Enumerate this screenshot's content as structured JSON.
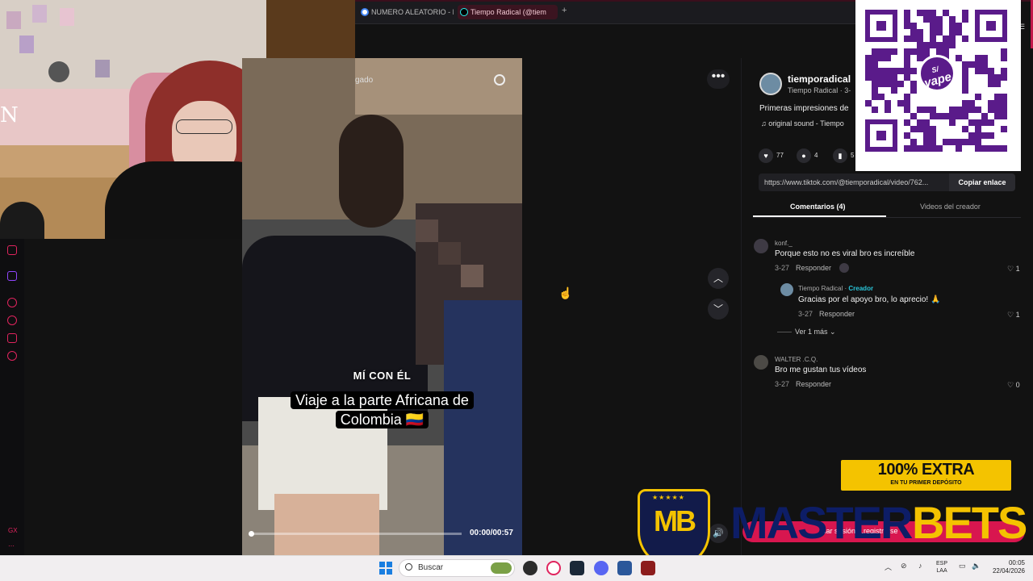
{
  "browser": {
    "tabs": [
      {
        "label": "NUMERO ALEATORIO - Bu",
        "active": false
      },
      {
        "label": "Tiempo Radical (@tiem",
        "active": true
      }
    ],
    "new_tab": "+"
  },
  "video": {
    "search_placeholder": "gado",
    "caption_tag": "MÍ CON ÉL",
    "caption": "Viaje a la parte Africana de Colombia 🇨🇴",
    "time": "00:00/00:57",
    "progress": 0.0
  },
  "creator": {
    "handle": "tiemporadical",
    "subtitle": "Tiempo Radical · 3-",
    "description": "Primeras impresiones de",
    "sound": "original sound - Tiempo"
  },
  "stats": {
    "likes": "77",
    "comments": "4",
    "saves": "5"
  },
  "link": {
    "url": "https://www.tiktok.com/@tiemporadical/video/762...",
    "copy_label": "Copiar enlace"
  },
  "panel_tabs": {
    "comments": "Comentarios (4)",
    "creator_videos": "Videos del creador"
  },
  "comments": [
    {
      "user": "konf._",
      "text": "Porque esto no es viral bro es increíble",
      "date": "3-27",
      "reply": "Responder",
      "likes": "1"
    },
    {
      "user": "Tiempo Radical",
      "creator_tag": "Creador",
      "text": "Gracias por el apoyo bro, lo aprecio! 🙏",
      "date": "3-27",
      "reply": "Responder",
      "likes": "1"
    },
    {
      "user": "WALTER .C.Q.",
      "text": "Bro me gustan tus vídeos",
      "date": "3-27",
      "reply": "Responder",
      "likes": "0"
    }
  ],
  "more_replies": "Ver 1 más",
  "qr": {
    "logo_text": "yape",
    "currency": "S/"
  },
  "ads": {
    "promo_big": "100% EXTRA",
    "promo_small": "EN TU PRIMER DEPÓSITO",
    "brand_initials": "MB",
    "brand_stars": "★★★★★",
    "brand_left": "MASTER",
    "brand_right": "BETS",
    "pink_text": "iciar sesión   ...registrarse"
  },
  "webcam": {
    "letter": "N"
  },
  "taskbar": {
    "search_label": "Buscar",
    "lang_top": "ESP",
    "lang_bottom": "LAA",
    "time": "00:05",
    "date": "22/04/2026"
  },
  "colors": {
    "accent": "#e0245e",
    "creator_tag": "#2ac4d8",
    "yape_purple": "#5a1b8a",
    "promo_yellow": "#f4c300"
  }
}
